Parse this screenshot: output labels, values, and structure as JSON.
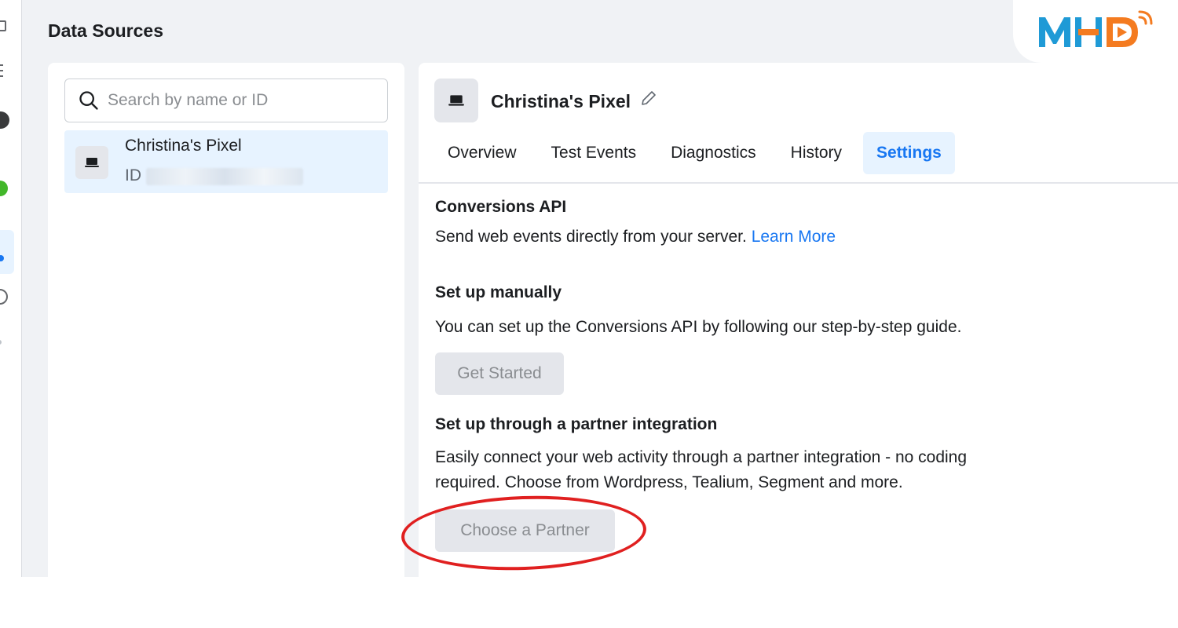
{
  "header": {
    "title": "Data Sources"
  },
  "search": {
    "placeholder": "Search by name or ID"
  },
  "source_list": {
    "items": [
      {
        "name": "Christina's Pixel",
        "id_label": "ID"
      }
    ]
  },
  "detail": {
    "title": "Christina's Pixel",
    "tabs": [
      {
        "label": "Overview"
      },
      {
        "label": "Test Events"
      },
      {
        "label": "Diagnostics"
      },
      {
        "label": "History"
      },
      {
        "label": "Settings",
        "active": true
      }
    ],
    "conversions_api": {
      "heading": "Conversions API",
      "description": "Send web events directly from your server.",
      "link": "Learn More"
    },
    "manual": {
      "heading": "Set up manually",
      "description": "You can set up the Conversions API by following our step-by-step guide.",
      "button": "Get Started"
    },
    "partner": {
      "heading": "Set up through a partner integration",
      "description_line1": "Easily connect your web activity through a partner integration - no coding",
      "description_line2": "required. Choose from Wordpress, Tealium, Segment and more.",
      "button": "Choose a Partner"
    }
  },
  "logo": {
    "text": "MHD",
    "colors": {
      "primary": "#1f9ad6",
      "accent": "#f47b20"
    }
  },
  "colors": {
    "accent": "#1877f2",
    "highlight": "#e02020",
    "active_bg": "#e7f3ff"
  }
}
